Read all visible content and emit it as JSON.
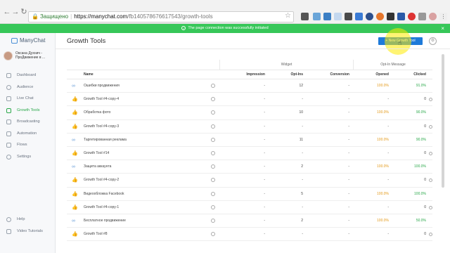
{
  "browser": {
    "secure_label": "Защищено",
    "url_host": "https://manychat.com",
    "url_path": "/fb140578676617543/growth-tools",
    "lock_icon": "🔒",
    "star_icon": "☆",
    "back_icon": "←",
    "forward_icon": "→",
    "reload_icon": "↻"
  },
  "toast": {
    "message": "The page connection was successfully initiated",
    "check_icon": "✓",
    "close_icon": "×"
  },
  "sidebar": {
    "brand": "ManyChat",
    "user_name_line1": "Оксана Духнич -",
    "user_name_line2": "ПроДвижение в ...",
    "items": [
      {
        "label": "Dashboard"
      },
      {
        "label": "Audience"
      },
      {
        "label": "Live Chat"
      },
      {
        "label": "Growth Tools"
      },
      {
        "label": "Broadcasting"
      },
      {
        "label": "Automation"
      },
      {
        "label": "Flows"
      },
      {
        "label": "Settings"
      }
    ],
    "bottom_items": [
      {
        "label": "Help"
      },
      {
        "label": "Video Tutorials"
      }
    ]
  },
  "main": {
    "title": "Growth Tools",
    "new_button": "+ New Growth Tool",
    "settings_icon": "⚙"
  },
  "table": {
    "group_widget": "Widget",
    "group_optin": "Opt-In Message",
    "col_name": "Name",
    "col_impressions": "Impression",
    "col_optins": "Opt-Ins",
    "col_conversion": "Conversion",
    "col_opened": "Opened",
    "col_clicked": "Clicked",
    "rows": [
      {
        "icon": "∞",
        "name": "Ошибки продвижения",
        "impressions": "-",
        "optins": "12",
        "conversion": "-",
        "opened": "100.0%",
        "clicked": "91.0%"
      },
      {
        "icon": "👍",
        "name": "Growth Tool #4-copy-4",
        "impressions": "-",
        "optins": "-",
        "conversion": "-",
        "opened": "-",
        "clicked": "0"
      },
      {
        "icon": "👍",
        "name": "Обработка фото",
        "impressions": "-",
        "optins": "10",
        "conversion": "-",
        "opened": "100.0%",
        "clicked": "90.0%"
      },
      {
        "icon": "👍",
        "name": "Growth Tool #4-copy-3",
        "impressions": "-",
        "optins": "-",
        "conversion": "-",
        "opened": "-",
        "clicked": "0"
      },
      {
        "icon": "∞",
        "name": "Таргетированная реклама",
        "impressions": "-",
        "optins": "11",
        "conversion": "-",
        "opened": "100.0%",
        "clicked": "90.0%"
      },
      {
        "icon": "👍",
        "name": "Growth Tool #14",
        "impressions": "-",
        "optins": "-",
        "conversion": "-",
        "opened": "-",
        "clicked": "0"
      },
      {
        "icon": "∞",
        "name": "Защита аккаунта",
        "impressions": "-",
        "optins": "2",
        "conversion": "-",
        "opened": "100.0%",
        "clicked": "100.0%"
      },
      {
        "icon": "👍",
        "name": "Growth Tool #4-copy-2",
        "impressions": "-",
        "optins": "-",
        "conversion": "-",
        "opened": "-",
        "clicked": "0"
      },
      {
        "icon": "👍",
        "name": "Видеообложка Facebook",
        "impressions": "-",
        "optins": "5",
        "conversion": "-",
        "opened": "100.0%",
        "clicked": "100.0%"
      },
      {
        "icon": "👍",
        "name": "Growth Tool #4-copy-1",
        "impressions": "-",
        "optins": "-",
        "conversion": "-",
        "opened": "-",
        "clicked": "0"
      },
      {
        "icon": "∞",
        "name": "Бесплатное продвижение",
        "impressions": "-",
        "optins": "2",
        "conversion": "-",
        "opened": "100.0%",
        "clicked": "50.0%"
      },
      {
        "icon": "👍",
        "name": "Growth Tool #8",
        "impressions": "-",
        "optins": "-",
        "conversion": "-",
        "opened": "-",
        "clicked": "0"
      }
    ]
  },
  "colors": {
    "toast_bg": "#37c759",
    "accent_blue": "#1e7ad9",
    "active_green": "#2aa84a",
    "opened_orange": "#e49a1a"
  }
}
